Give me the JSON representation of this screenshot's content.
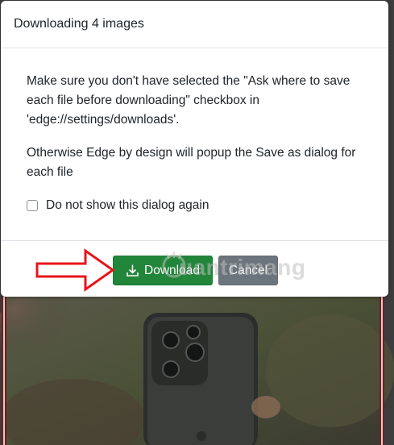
{
  "dialog": {
    "title": "Downloading 4 images",
    "paragraph1": "Make sure you don't have selected the \"Ask where to save each file before downloading\" checkbox in 'edge://settings/downloads'.",
    "paragraph2": "Otherwise Edge by design will popup the Save as dialog for each file",
    "checkbox_label": "Do not show this dialog again",
    "checkbox_checked": false,
    "download_label": "Download",
    "cancel_label": "Cancel"
  },
  "watermark": {
    "text": "uantrimang"
  },
  "icons": {
    "download": "download-icon",
    "arrow": "red-arrow-icon"
  },
  "colors": {
    "download_button": "#22863a",
    "cancel_button": "#6c757d",
    "annotation_arrow": "#e8141a",
    "backdrop": "#3f3f3f"
  }
}
